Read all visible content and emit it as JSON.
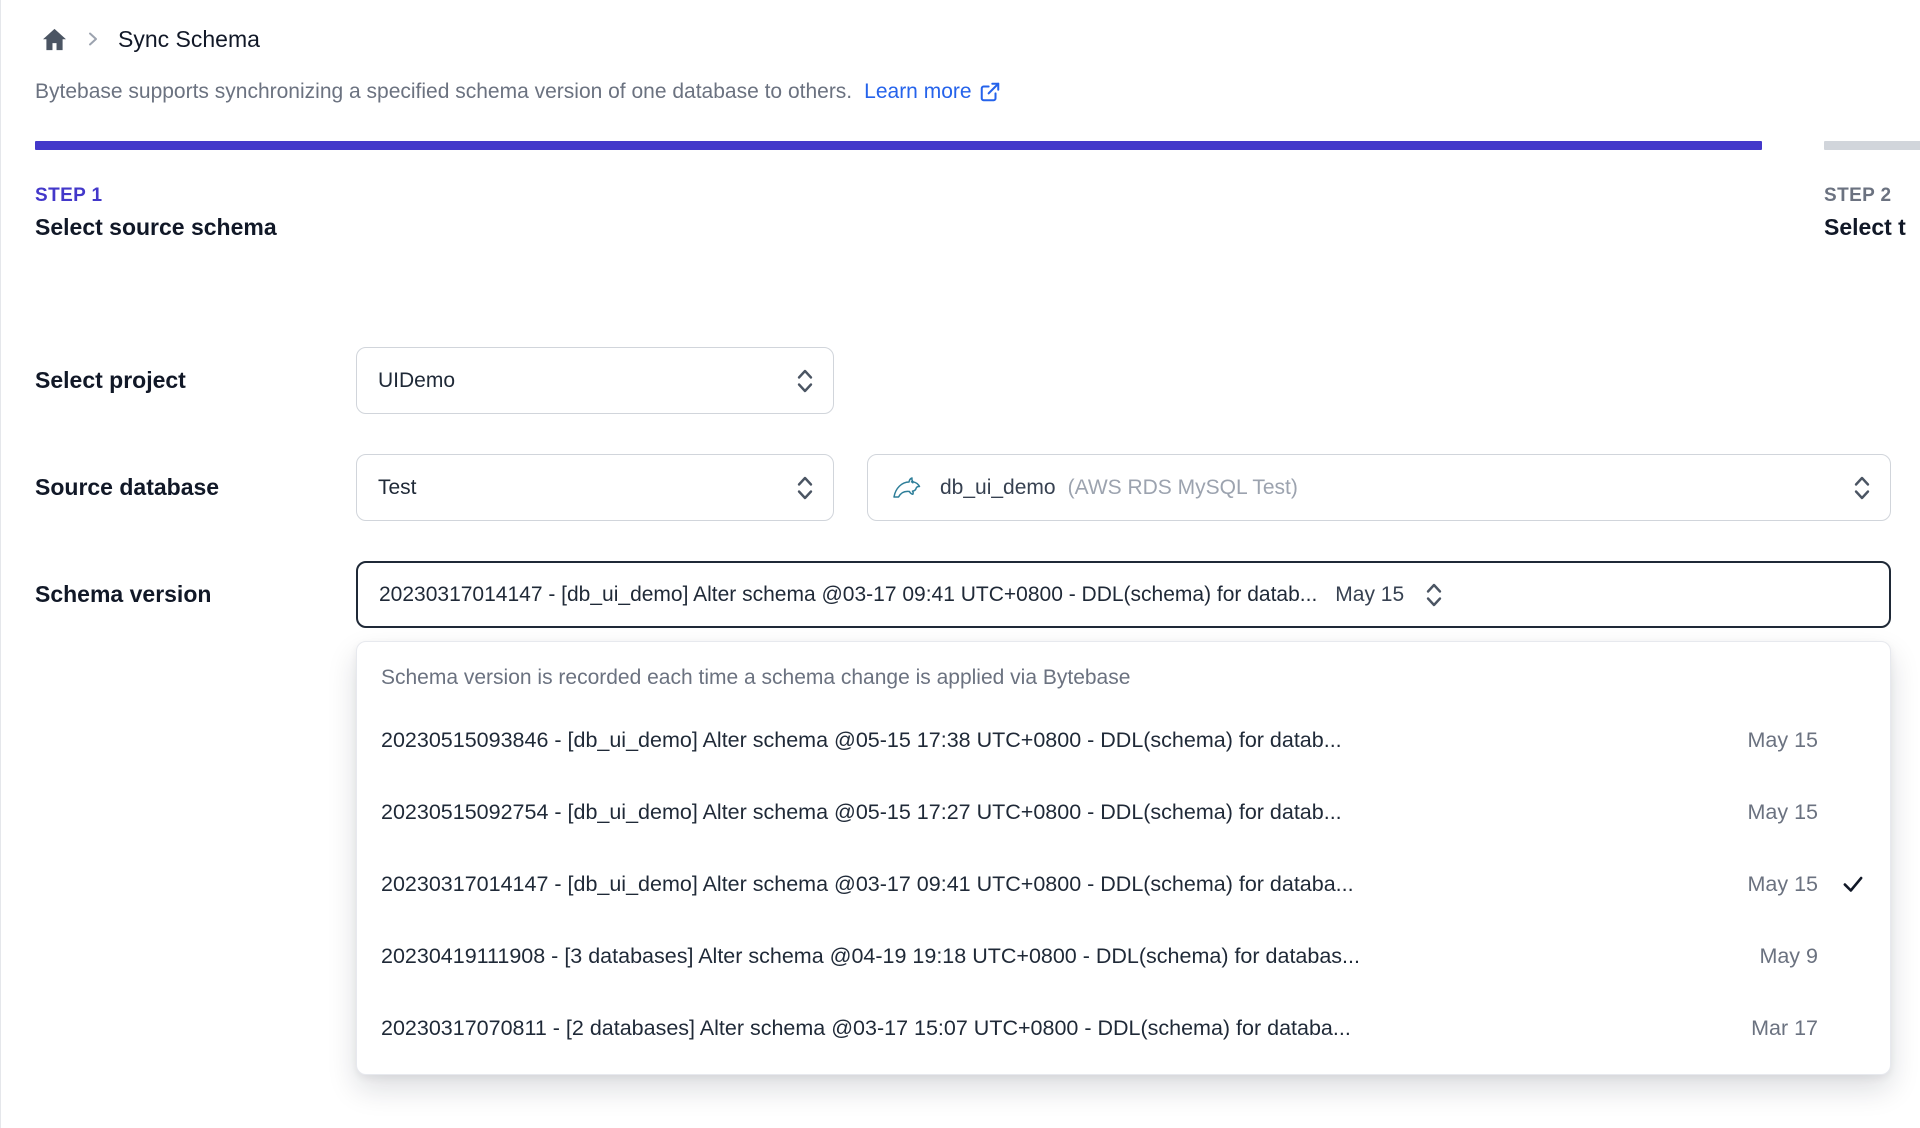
{
  "breadcrumb": {
    "page_title": "Sync Schema"
  },
  "intro": {
    "text": "Bytebase supports synchronizing a specified schema version of one database to others.",
    "link_label": "Learn more"
  },
  "steps": [
    {
      "label": "STEP 1",
      "title": "Select source schema",
      "active": true
    },
    {
      "label": "STEP 2",
      "title": "Select t",
      "active": false
    }
  ],
  "form": {
    "project": {
      "label": "Select project",
      "value": "UIDemo"
    },
    "source_database": {
      "label": "Source database",
      "environment_value": "Test",
      "db_name": "db_ui_demo",
      "db_detail": "(AWS RDS MySQL Test)"
    },
    "schema_version": {
      "label": "Schema version",
      "value": "20230317014147 - [db_ui_demo] Alter schema @03-17 09:41 UTC+0800 - DDL(schema) for datab...",
      "date": "May 15"
    }
  },
  "dropdown": {
    "hint": "Schema version is recorded each time a schema change is applied via Bytebase",
    "options": [
      {
        "text": "20230515093846 - [db_ui_demo] Alter schema @05-15 17:38 UTC+0800 - DDL(schema) for datab...",
        "date": "May 15",
        "selected": false
      },
      {
        "text": "20230515092754 - [db_ui_demo] Alter schema @05-15 17:27 UTC+0800 - DDL(schema) for datab...",
        "date": "May 15",
        "selected": false
      },
      {
        "text": "20230317014147 - [db_ui_demo] Alter schema @03-17 09:41 UTC+0800 - DDL(schema) for databa...",
        "date": "May 15",
        "selected": true
      },
      {
        "text": "20230419111908 - [3 databases] Alter schema @04-19 19:18 UTC+0800 - DDL(schema) for databas...",
        "date": "May 9",
        "selected": false
      },
      {
        "text": "20230317070811 - [2 databases] Alter schema @03-17 15:07 UTC+0800 - DDL(schema) for databa...",
        "date": "Mar 17",
        "selected": false
      }
    ]
  },
  "icons": [
    "home-icon",
    "chevron-right-icon",
    "external-link-icon",
    "chevron-up-down-icon",
    "mysql-dolphin-icon",
    "check-icon"
  ],
  "colors": {
    "accent_indigo": "#4338ca",
    "link_blue": "#2563eb",
    "inactive_gray": "#d1d5db",
    "text_gray": "#6b7280",
    "focus_border": "#1f2937",
    "mysql_teal": "#2e7e99"
  }
}
